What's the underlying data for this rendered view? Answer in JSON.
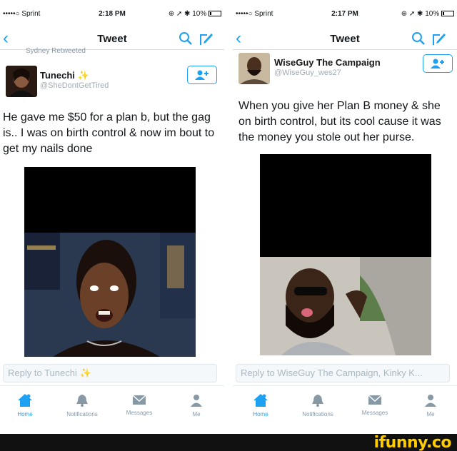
{
  "left": {
    "status": {
      "carrier": "•••••○ Sprint",
      "time": "2:18 PM",
      "battery": "10%"
    },
    "nav": {
      "back": "‹",
      "title": "Tweet"
    },
    "retweeted": "Sydney Retweeted",
    "user": {
      "name": "Tunechi",
      "sparkle": "✨",
      "handle": "@SheDontGetTired"
    },
    "tweet": "He gave me $50 for a plan b, but the gag is.. I was on birth control & now im bout to get my nails done",
    "reply_placeholder": "Reply to Tunechi",
    "reply_sparkle": "✨",
    "tabs": [
      "Home",
      "Notifications",
      "Messages",
      "Me"
    ]
  },
  "right": {
    "status": {
      "carrier": "•••••○ Sprint",
      "time": "2:17 PM",
      "battery": "10%"
    },
    "nav": {
      "back": "‹",
      "title": "Tweet"
    },
    "user": {
      "name": "WiseGuy The Campaign",
      "handle": "@WiseGuy_wes27"
    },
    "tweet": "When you give her Plan B money & she on birth control, but its cool cause it was the money you stole out her purse.",
    "reply_placeholder": "Reply to WiseGuy The Campaign, Kinky K...",
    "tabs": [
      "Home",
      "Notifications",
      "Messages",
      "Me"
    ]
  },
  "colors": {
    "accent": "#1da1f2",
    "muted": "#8899a6",
    "footer": "#111111",
    "logo": "#ffcc00"
  },
  "footer": {
    "logo": "ifunny.co"
  }
}
